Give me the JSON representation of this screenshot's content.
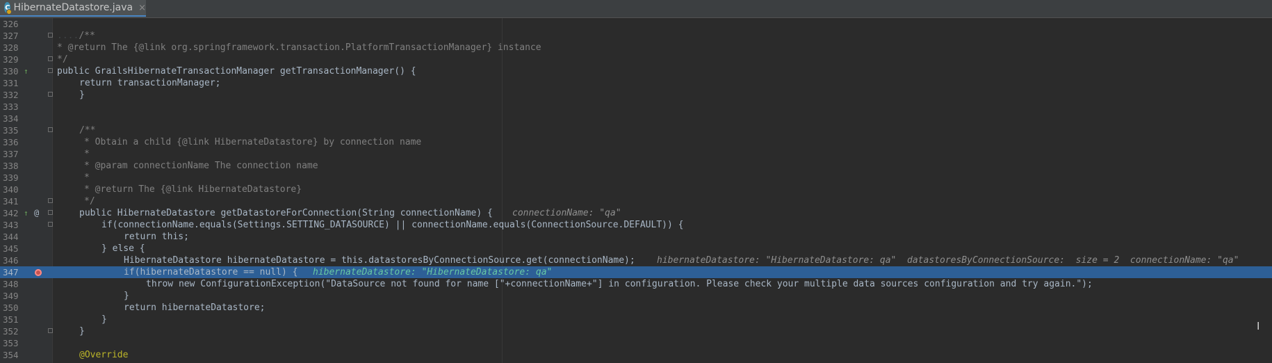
{
  "tab": {
    "icon_letter": "C",
    "title": "HibernateDatastore.java",
    "close": "×"
  },
  "lines": [
    {
      "n": "326",
      "code": ""
    },
    {
      "n": "327",
      "code": "/**"
    },
    {
      "n": "328",
      "code": "* @return The {@link org.springframework.transaction.PlatformTransactionManager} instance"
    },
    {
      "n": "329",
      "code": "*/"
    },
    {
      "n": "330",
      "code": "public GrailsHibernateTransactionManager getTransactionManager() {"
    },
    {
      "n": "331",
      "code": "return transactionManager;"
    },
    {
      "n": "332",
      "code": "}"
    },
    {
      "n": "333",
      "code": ""
    },
    {
      "n": "334",
      "code": ""
    },
    {
      "n": "335",
      "code": "/**"
    },
    {
      "n": "336",
      "code": "* Obtain a child {@link HibernateDatastore} by connection name"
    },
    {
      "n": "337",
      "code": "*"
    },
    {
      "n": "338",
      "code": "* @param connectionName The connection name"
    },
    {
      "n": "339",
      "code": "*"
    },
    {
      "n": "340",
      "code": "* @return The {@link HibernateDatastore}"
    },
    {
      "n": "341",
      "code": "*/"
    },
    {
      "n": "342",
      "code": "public HibernateDatastore getDatastoreForConnection(String connectionName) {"
    },
    {
      "n": "343",
      "code": "if(connectionName.equals(Settings.SETTING_DATASOURCE) || connectionName.equals(ConnectionSource.DEFAULT)) {"
    },
    {
      "n": "344",
      "code": "return this;"
    },
    {
      "n": "345",
      "code": "} else {"
    },
    {
      "n": "346",
      "code": "HibernateDatastore hibernateDatastore = this.datastoresByConnectionSource.get(connectionName);"
    },
    {
      "n": "347",
      "code": "if(hibernateDatastore == null) {"
    },
    {
      "n": "348",
      "code": "throw new ConfigurationException(\"DataSource not found for name [\"+connectionName+\"] in configuration. Please check your multiple data sources configuration and try again.\");"
    },
    {
      "n": "349",
      "code": "}"
    },
    {
      "n": "350",
      "code": "return hibernateDatastore;"
    },
    {
      "n": "351",
      "code": "}"
    },
    {
      "n": "352",
      "code": "}"
    },
    {
      "n": "353",
      "code": ""
    },
    {
      "n": "354",
      "code": "@Override"
    }
  ],
  "inlay_hints": {
    "l342": "connectionName: \"qa\"",
    "l346": "hibernateDatastore: \"HibernateDatastore: qa\"  datastoresByConnectionSource:  size = 2  connectionName: \"qa\"",
    "l347": "hibernateDatastore: \"HibernateDatastore: qa\""
  },
  "selected_line": "347",
  "breakpoint_line": "347",
  "gutter_icons": {
    "run": "↑",
    "annotation": "@"
  },
  "text_cursor": "I",
  "colors": {
    "background": "#2b2b2b",
    "selection": "#2d5f96",
    "keyword": "#cc7832",
    "string": "#6a8759",
    "method": "#ffc66d"
  }
}
